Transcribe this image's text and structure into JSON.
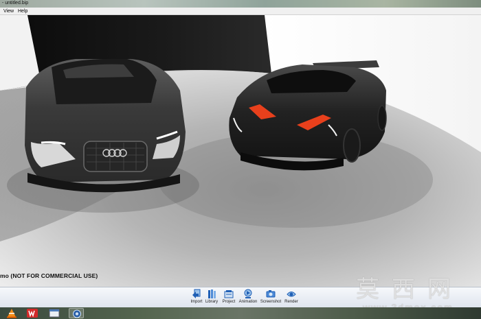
{
  "window": {
    "title": "- untitled.bip"
  },
  "menu": {
    "items": [
      "View",
      "Help"
    ]
  },
  "viewport": {
    "demo_notice": "mo (NOT FOR COMMERCIAL USE)"
  },
  "toolbar": {
    "items": [
      {
        "label": "Import",
        "icon": "import-icon"
      },
      {
        "label": "Library",
        "icon": "library-icon"
      },
      {
        "label": "Project",
        "icon": "project-icon"
      },
      {
        "label": "Animation",
        "icon": "animation-icon"
      },
      {
        "label": "Screenshot",
        "icon": "screenshot-icon"
      },
      {
        "label": "Render",
        "icon": "render-icon"
      }
    ]
  },
  "watermark": {
    "chinese": "莫西网",
    "url": "www.3dmox.com"
  },
  "taskbar": {
    "apps": [
      "vlc-icon",
      "app-3dsmax-icon",
      "window-icon",
      "keyshot-icon"
    ]
  },
  "colors": {
    "accent_red": "#e8401c",
    "toolbar_blue": "#1f5fb5"
  }
}
